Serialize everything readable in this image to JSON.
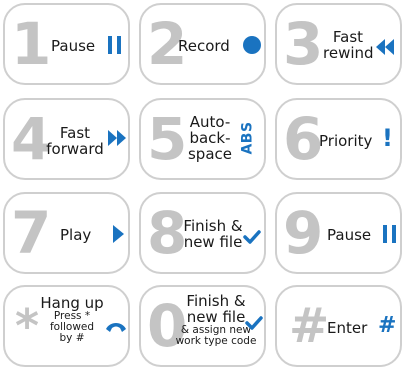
{
  "keys": [
    {
      "number": "1",
      "label": "Pause",
      "icon": "pause-icon"
    },
    {
      "number": "2",
      "label": "Record",
      "icon": "record-icon"
    },
    {
      "number": "3",
      "label_line1": "Fast",
      "label_line2": "rewind",
      "icon": "fast-rewind-icon"
    },
    {
      "number": "4",
      "label_line1": "Fast",
      "label_line2": "forward",
      "icon": "fast-forward-icon"
    },
    {
      "number": "5",
      "label_line1": "Auto-",
      "label_line2": "back-",
      "label_line3": "space",
      "badge": "ABS"
    },
    {
      "number": "6",
      "label": "Priority",
      "icon": "exclamation-icon",
      "glyph": "!"
    },
    {
      "number": "7",
      "label": "Play",
      "icon": "play-icon"
    },
    {
      "number": "8",
      "label_line1": "Finish &",
      "label_line2": "new file",
      "icon": "checkmark-icon"
    },
    {
      "number": "9",
      "label": "Pause",
      "icon": "pause-icon"
    },
    {
      "number": "*",
      "label": "Hang up",
      "sub_line1": "Press *",
      "sub_line2": "followed",
      "sub_line3": "by #",
      "icon": "hang-up-phone-icon"
    },
    {
      "number": "0",
      "label_line1": "Finish &",
      "label_line2": "new file",
      "sub_line1": "& assign new",
      "sub_line2": "work type code",
      "icon": "checkmark-icon"
    },
    {
      "number": "#",
      "label": "Enter",
      "icon": "hash-icon",
      "glyph": "#"
    }
  ],
  "colors": {
    "accent": "#1a73c0",
    "digit": "#c4c4c4",
    "border": "#cfcfcf",
    "text": "#1a1a1a"
  }
}
